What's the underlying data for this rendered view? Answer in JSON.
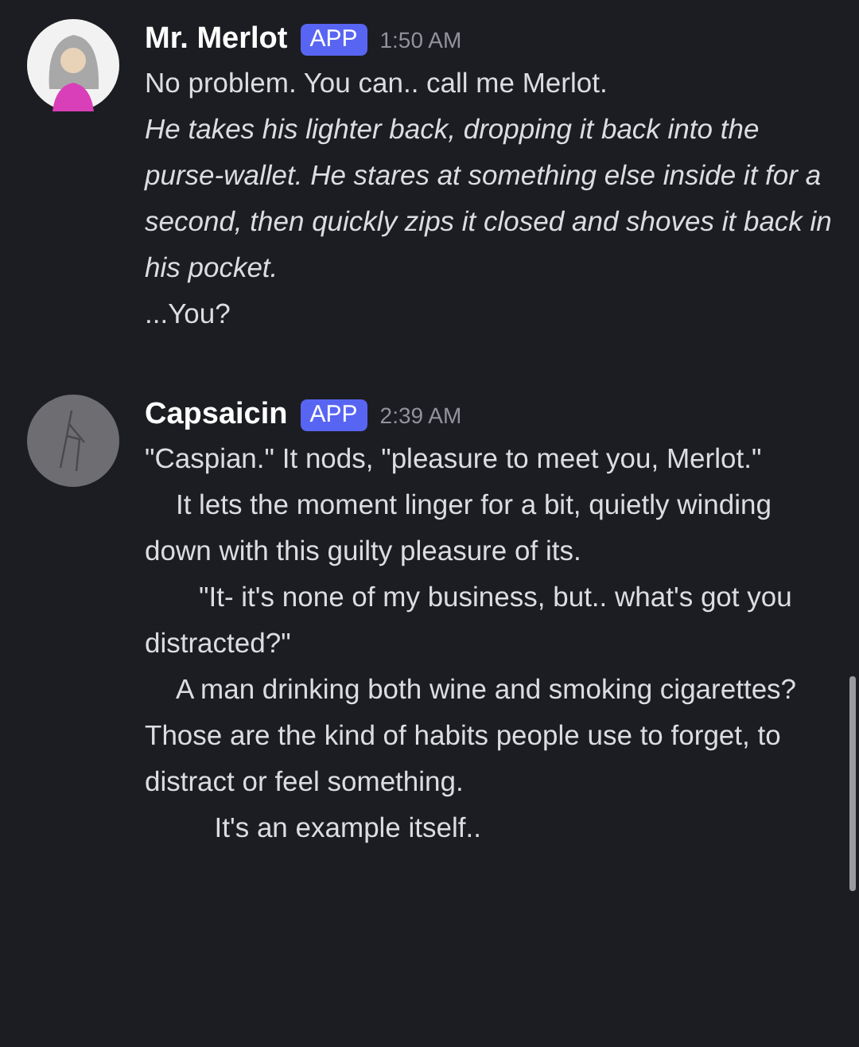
{
  "messages": [
    {
      "author": "Mr. Merlot",
      "badge": "APP",
      "time": "1:50 AM",
      "kind": "light",
      "paragraphs": [
        {
          "text": "No problem. You can.. call me Merlot.",
          "italic": false
        },
        {
          "text": "He takes his lighter back, dropping it back into the purse-wallet. He stares at something else inside it for a second, then quickly zips it closed and shoves it back in his pocket.",
          "italic": true
        },
        {
          "text": "...You?",
          "italic": false
        }
      ]
    },
    {
      "author": "Capsaicin",
      "badge": "APP",
      "time": "2:39 AM",
      "kind": "sketch",
      "paragraphs": [
        {
          "text": "\"Caspian.\" It nods, \"pleasure to meet you, Merlot.\"",
          "italic": false
        },
        {
          "text": "    It lets the moment linger for a bit, quietly winding down with this guilty pleasure of its.",
          "italic": false
        },
        {
          "text": "       \"It- it's none of my business, but.. what's got you distracted?\"",
          "italic": false
        },
        {
          "text": "    A man drinking both wine and smoking cigarettes? Those are the kind of habits people use to forget, to distract or feel something.",
          "italic": false
        },
        {
          "text": "         It's an example itself..",
          "italic": false
        }
      ]
    }
  ]
}
